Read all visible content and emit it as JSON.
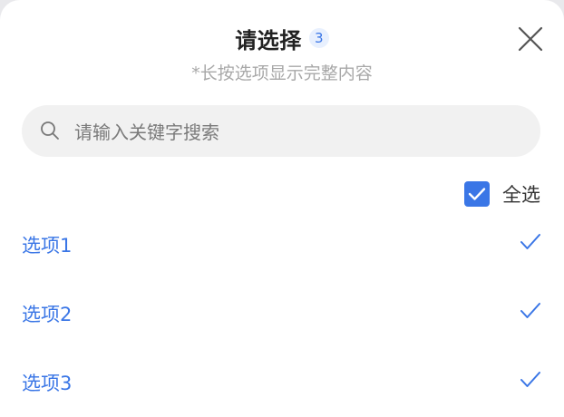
{
  "header": {
    "title": "请选择",
    "selected_count": "3"
  },
  "hint": "*长按选项显示完整内容",
  "search": {
    "placeholder": "请输入关键字搜索",
    "value": ""
  },
  "select_all": {
    "label": "全选",
    "checked": true
  },
  "options": [
    {
      "label": "选项1",
      "selected": true
    },
    {
      "label": "选项2",
      "selected": true
    },
    {
      "label": "选项3",
      "selected": true
    }
  ],
  "colors": {
    "accent": "#3a76e6",
    "badge_bg": "#e8f0fe",
    "search_bg": "#f1f1f1",
    "hint_text": "#a8a8a8"
  },
  "icons": {
    "close": "close-icon",
    "search": "search-icon",
    "checkbox": "checkbox-checked-icon",
    "option_selected": "check-icon"
  }
}
